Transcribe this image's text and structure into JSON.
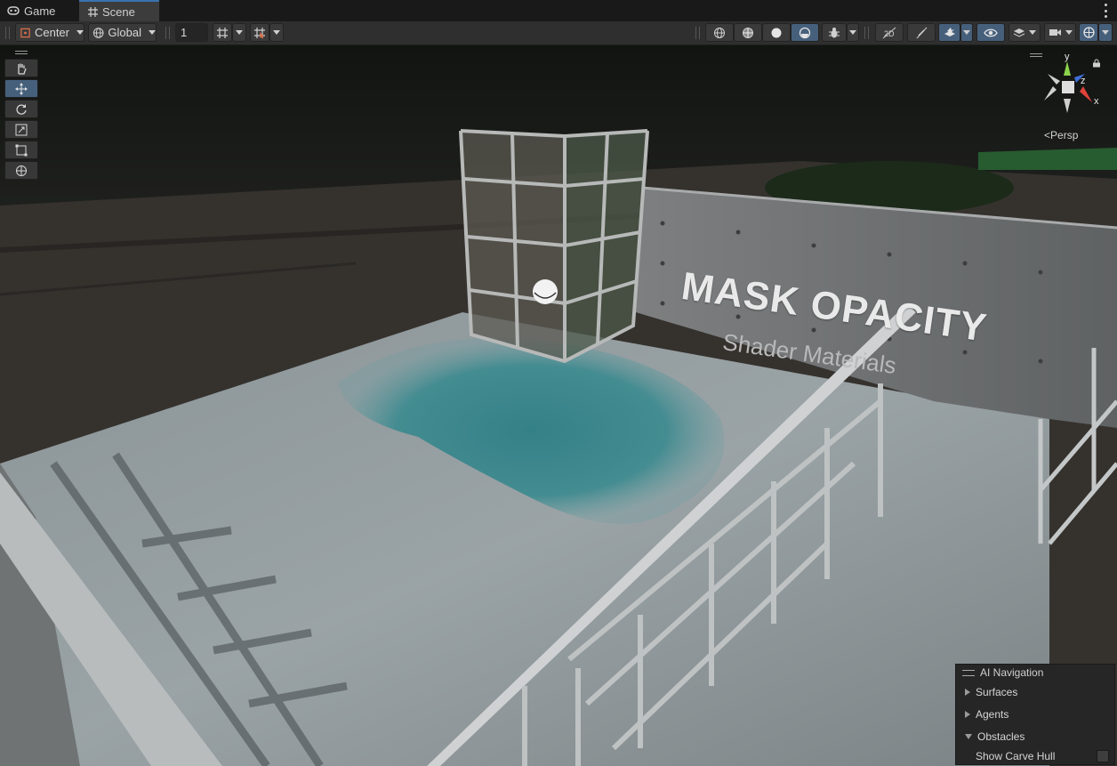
{
  "tabs": [
    {
      "label": "Game",
      "icon": "gamepad-icon",
      "active": false
    },
    {
      "label": "Scene",
      "icon": "grid-hash-icon",
      "active": true
    }
  ],
  "toolbar": {
    "pivot_mode": "Center",
    "pivot_rotation": "Global",
    "grid_snap_value": "1"
  },
  "tools": [
    "hand-tool",
    "move-tool",
    "rotate-tool",
    "scale-tool",
    "rect-tool",
    "transform-tool"
  ],
  "viewport": {
    "wall_title": "MASK OPACITY",
    "wall_subtitle": "Shader Materials",
    "projection": "Persp",
    "axes": {
      "y": "y",
      "z": "z",
      "x": "x"
    }
  },
  "ai_navigation": {
    "title": "AI Navigation",
    "sections": [
      {
        "label": "Surfaces",
        "expanded": false
      },
      {
        "label": "Agents",
        "expanded": false
      },
      {
        "label": "Obstacles",
        "expanded": true
      }
    ],
    "obstacle_option": "Show Carve Hull",
    "obstacle_option_checked": false
  },
  "colors": {
    "accent": "#46607c",
    "tab_highlight": "#3a72b0",
    "axis_y": "#8bd34a",
    "axis_x": "#e0433a",
    "axis_z": "#3e6fd8"
  }
}
